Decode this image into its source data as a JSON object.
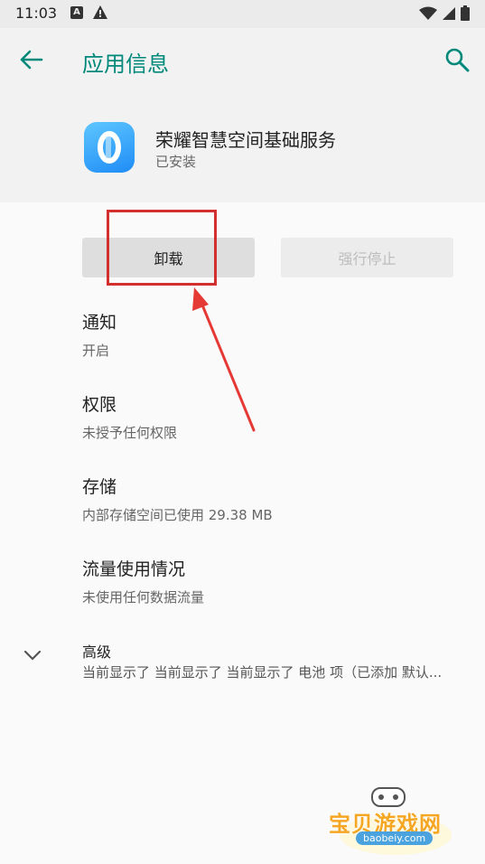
{
  "status_bar": {
    "time": "11:03",
    "badge": "A"
  },
  "app_bar": {
    "title": "应用信息"
  },
  "app": {
    "name": "荣耀智慧空间基础服务",
    "status": "已安装"
  },
  "buttons": {
    "uninstall": "卸载",
    "force_stop": "强行停止"
  },
  "prefs": [
    {
      "title": "通知",
      "summary": "开启"
    },
    {
      "title": "权限",
      "summary": "未授予任何权限"
    },
    {
      "title": "存储",
      "summary": "内部存储空间已使用 29.38 MB"
    },
    {
      "title": "流量使用情况",
      "summary": "未使用任何数据流量"
    }
  ],
  "advanced": {
    "title": "高级",
    "summary": "当前显示了 当前显示了 当前显示了 电池 项（已添加 默认..."
  },
  "watermark": {
    "text": "宝贝游戏网",
    "url": "baobeiy.com"
  },
  "colors": {
    "accent": "#00897b",
    "annotation": "#d32f2f"
  }
}
